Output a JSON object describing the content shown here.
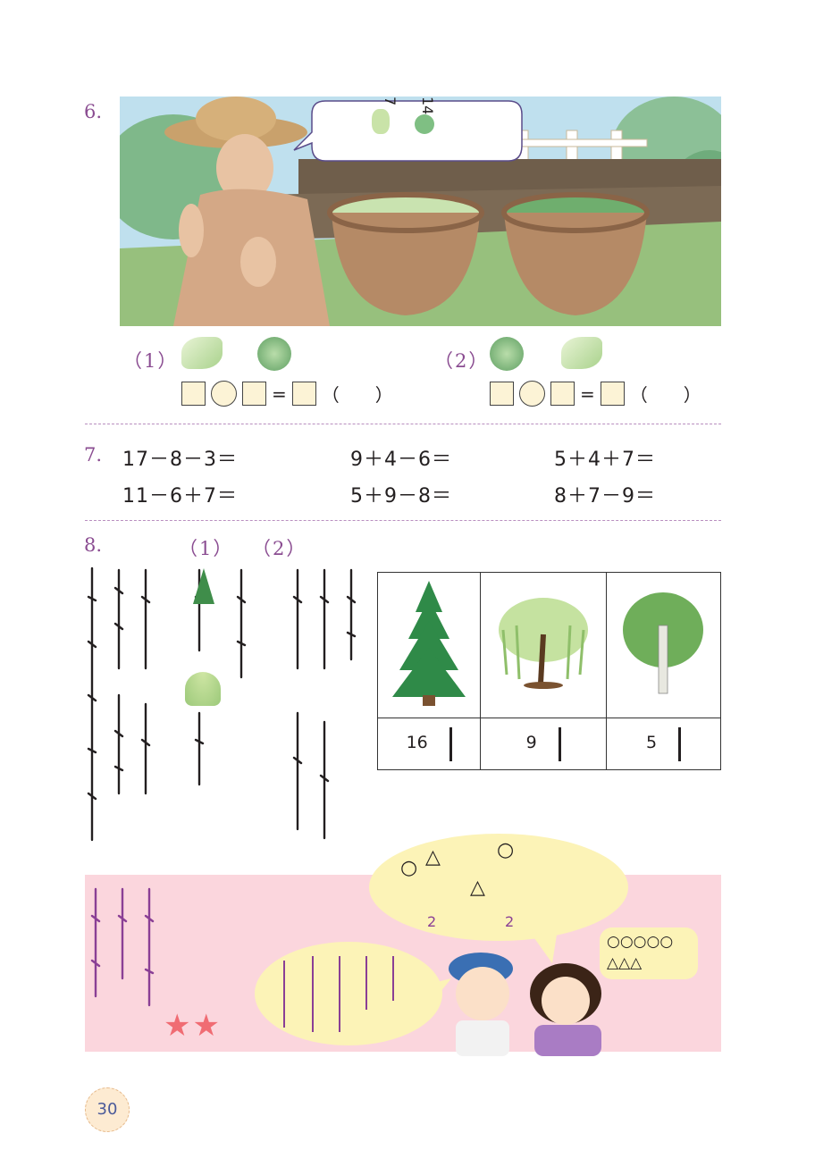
{
  "q6": {
    "number": "6.",
    "speech_numbers": [
      "7",
      "14"
    ],
    "part1_label": "（1）",
    "part2_label": "（2）",
    "equals": "=",
    "paren": "（　　）"
  },
  "q7": {
    "number": "7.",
    "equations": [
      [
        "17－8－3＝",
        "9＋4－6＝",
        "5＋4＋7＝"
      ],
      [
        "11－6＋7＝",
        "5＋9－8＝",
        "8＋7－9＝"
      ]
    ]
  },
  "q8": {
    "number": "8.",
    "part1_label": "（1）",
    "part2_label": "（2）",
    "tree_counts": [
      "16",
      "9",
      "5"
    ]
  },
  "pink_box": {
    "bubble_numbers": [
      "2",
      "2"
    ],
    "shapes_circles": "○○○○○",
    "shapes_triangles": "△△△",
    "star_rating": "★★"
  },
  "page_number": "30",
  "icons": [
    "cabbage-icon",
    "chinese-cabbage-icon",
    "pine-tree-icon",
    "willow-tree-icon",
    "birch-tree-icon",
    "star-icon"
  ]
}
